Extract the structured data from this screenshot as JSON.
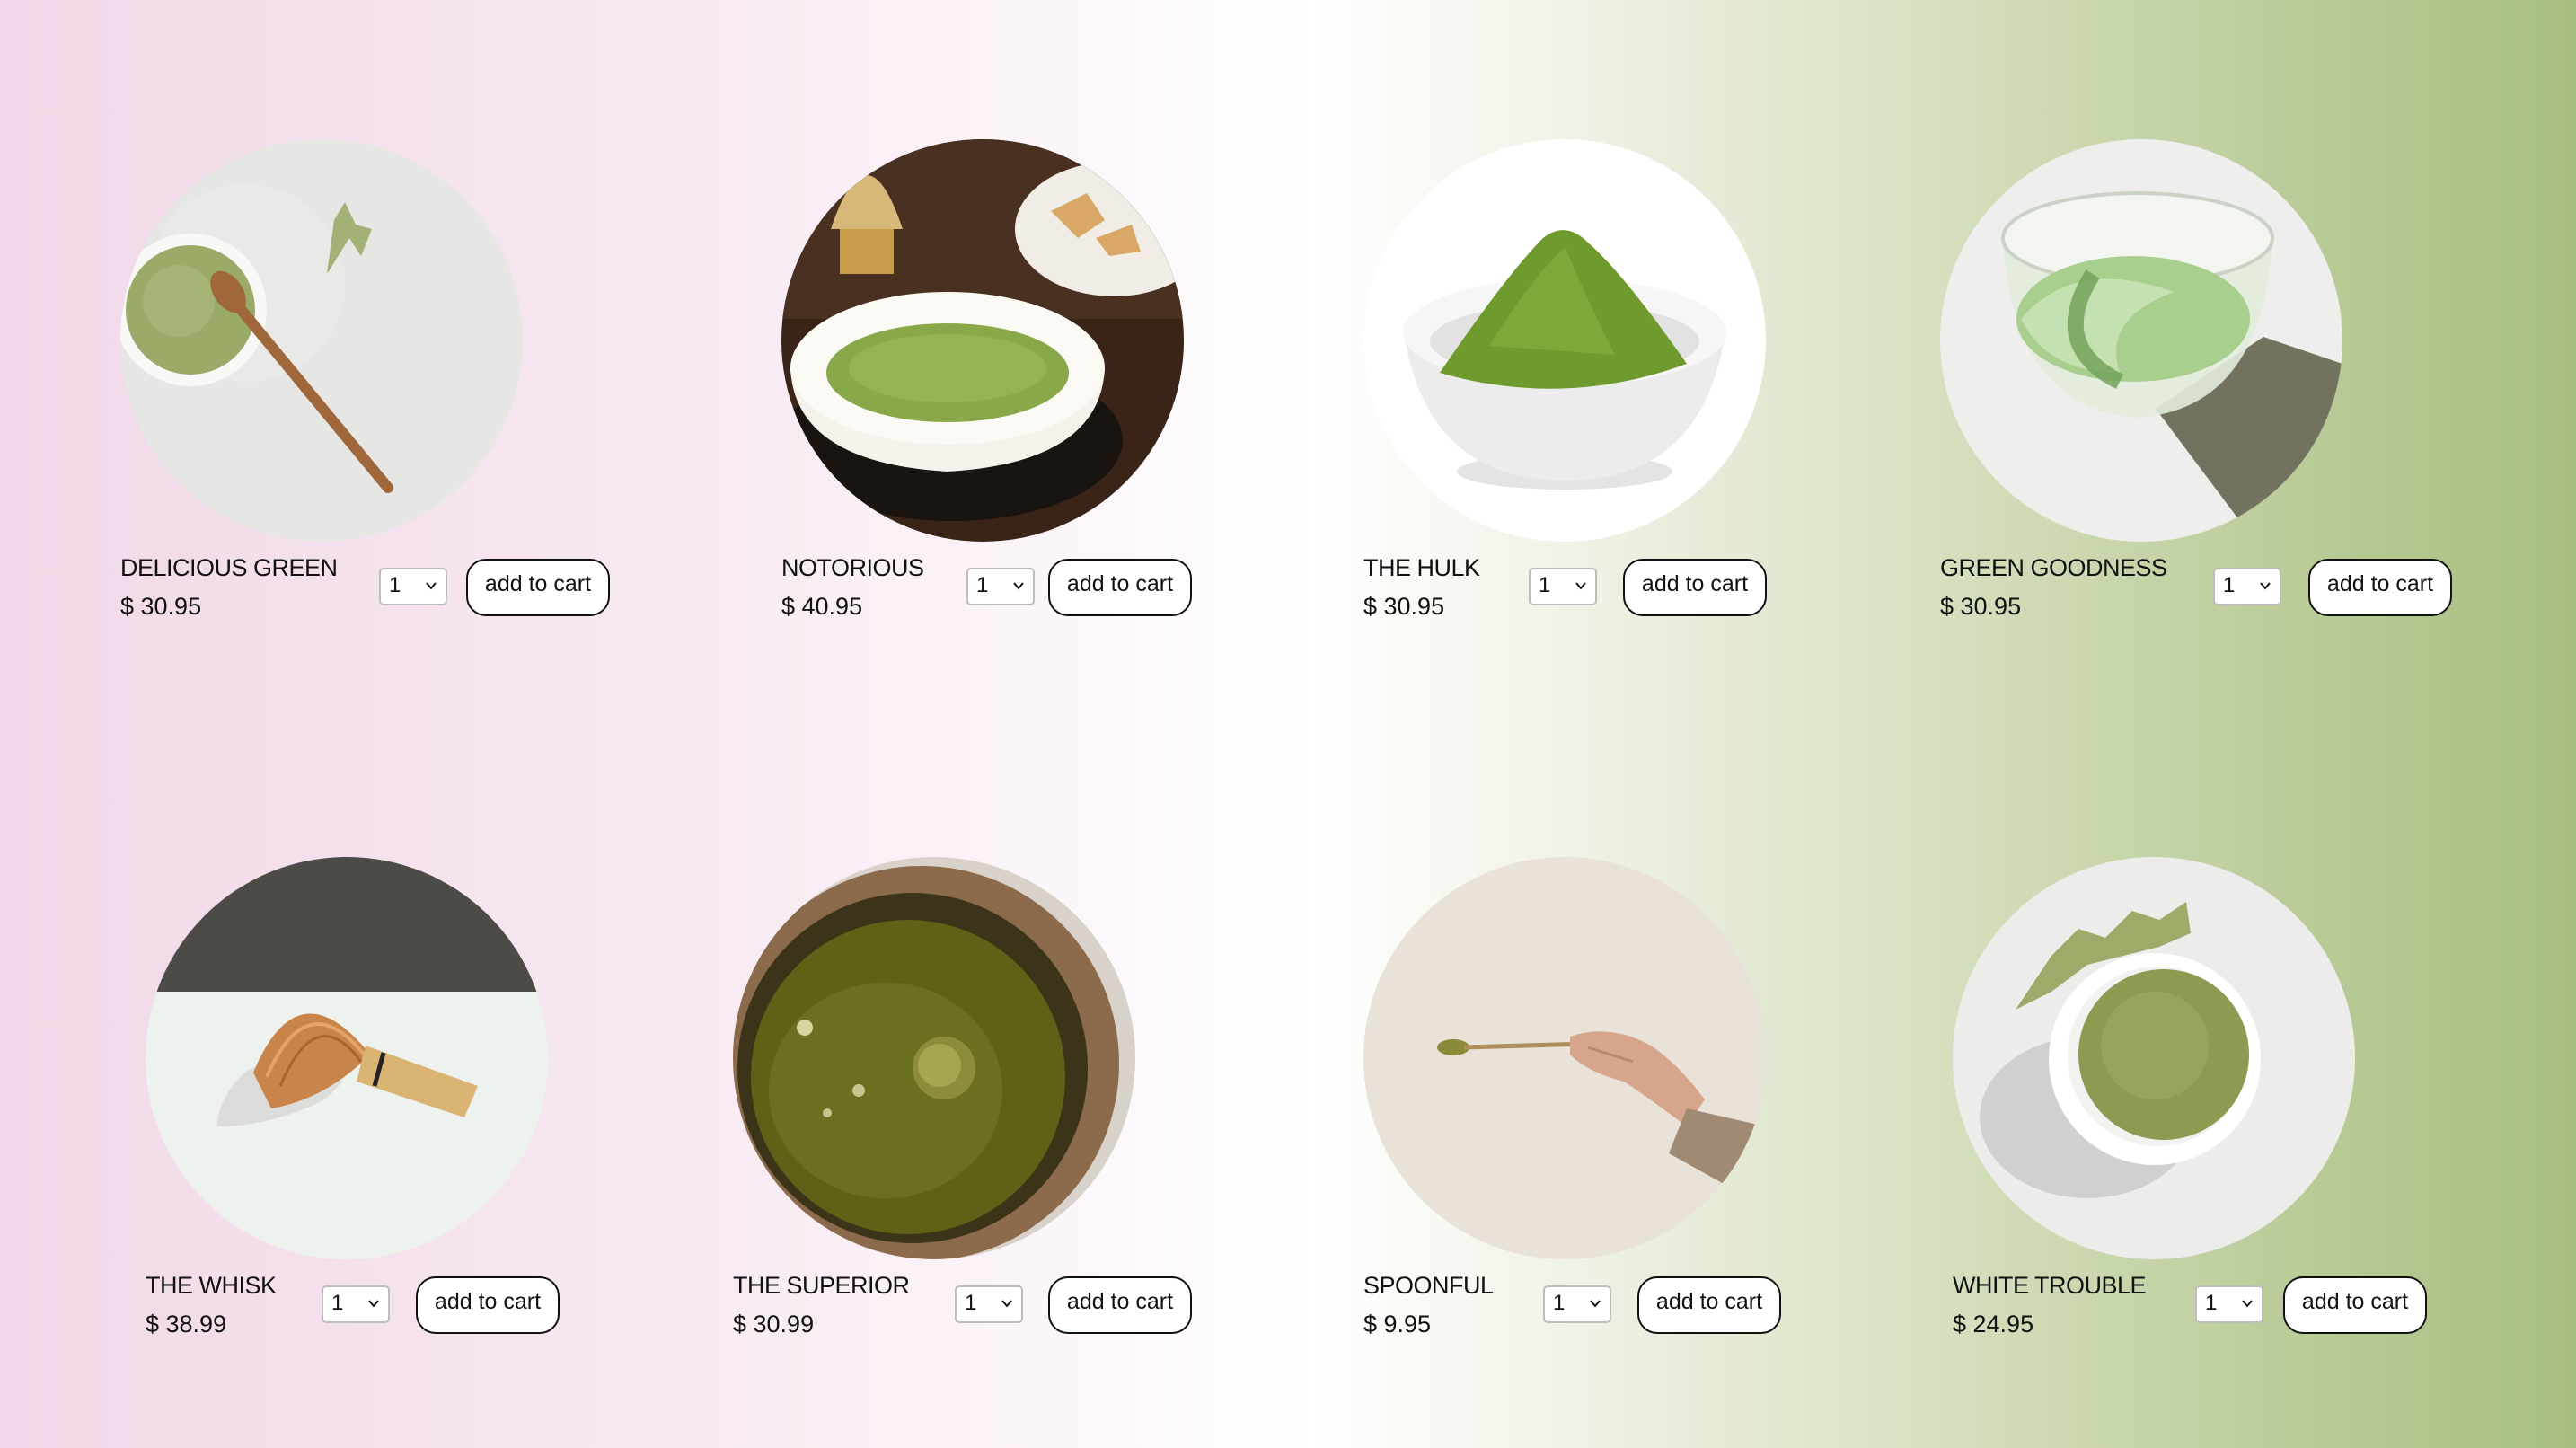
{
  "products": [
    {
      "name": "DELICIOUS GREEN",
      "price": "$ 30.95",
      "qty": "1",
      "button": "add to cart",
      "image": "matcha-powder-bowl-with-wooden-spoon"
    },
    {
      "name": "NOTORIOUS",
      "price": "$ 40.95",
      "qty": "1",
      "button": "add to cart",
      "image": "matcha-tea-bowl-with-whisk"
    },
    {
      "name": "THE HULK",
      "price": "$ 30.95",
      "qty": "1",
      "button": "add to cart",
      "image": "matcha-powder-heap-white-bowl"
    },
    {
      "name": "GREEN GOODNESS",
      "price": "$ 30.95",
      "qty": "1",
      "button": "add to cart",
      "image": "glass-bowl-matcha-latte"
    },
    {
      "name": "THE WHISK",
      "price": "$ 38.99",
      "qty": "1",
      "button": "add to cart",
      "image": "bamboo-whisk"
    },
    {
      "name": "THE SUPERIOR",
      "price": "$ 30.99",
      "qty": "1",
      "button": "add to cart",
      "image": "matcha-cup-closeup"
    },
    {
      "name": "SPOONFUL",
      "price": "$ 9.95",
      "qty": "1",
      "button": "add to cart",
      "image": "hand-holding-matcha-spoon"
    },
    {
      "name": "WHITE TROUBLE",
      "price": "$ 24.95",
      "qty": "1",
      "button": "add to cart",
      "image": "matcha-powder-white-bowl"
    }
  ],
  "colors": {
    "background_left": "#f1d8e8",
    "background_right": "#a8be7f",
    "matcha_green": "#8a9f4e",
    "button_border": "#111111"
  }
}
